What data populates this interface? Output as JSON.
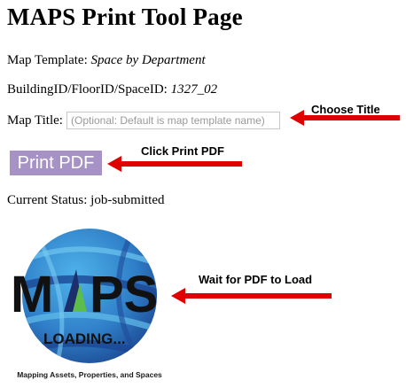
{
  "page": {
    "title": "MAPS Print Tool Page",
    "map_template_label": "Map Template:",
    "map_template_value": "Space by Department",
    "building_label": "BuildingID/FloorID/SpaceID:",
    "building_value": "1327_02",
    "map_title_label": "Map Title:",
    "map_title_placeholder": "(Optional: Default is map template name)",
    "print_button": "Print PDF",
    "status_label": "Current Status:",
    "status_value": "job-submitted"
  },
  "annotations": {
    "choose_title": "Choose Title",
    "click_print": "Click Print PDF",
    "wait_pdf": "Wait for PDF to Load"
  },
  "logo": {
    "wordmark_m": "M",
    "wordmark_ps": "PS",
    "loading": "LOADING...",
    "tagline": "Mapping Assets, Properties, and Spaces"
  },
  "colors": {
    "button_bg": "#a692c5",
    "arrow": "#e00000",
    "globe_dark": "#1b3f8c",
    "globe_light": "#3aa0dc"
  }
}
